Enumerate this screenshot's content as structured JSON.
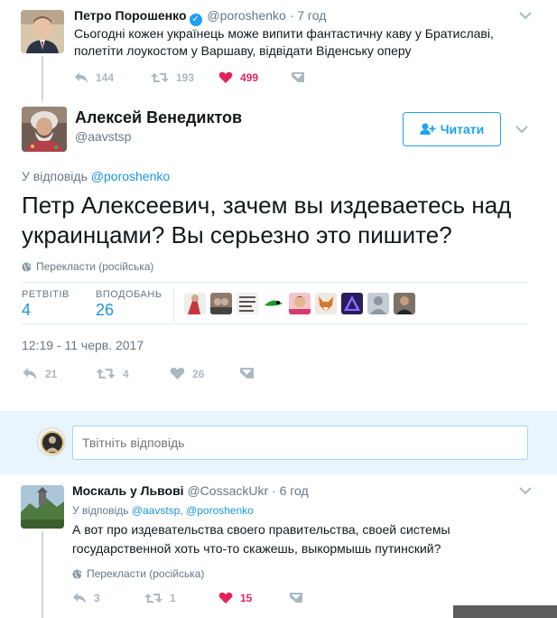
{
  "parent_tweet": {
    "name": "Петро Порошенко",
    "handle": "@poroshenko",
    "time": "· 7 год",
    "text": "Сьогодні кожен українець може випити фантастичну каву у Братиславі, полетіти лоукостом у Варшаву, відвідати Віденську оперу",
    "replies": "144",
    "retweets": "193",
    "likes": "499"
  },
  "main_tweet": {
    "name": "Алексей Венедиктов",
    "handle": "@aavstsp",
    "follow_label": "Читати",
    "reply_prefix": "У відповідь",
    "reply_to": "@poroshenko",
    "text": "Петр Алексеевич, зачем вы издеваетесь над украинцами? Вы серьезно это пишите?",
    "translate": "Перекласти (російська)",
    "retweets_label": "РЕТВІТІВ",
    "retweets_value": "4",
    "likes_label": "ВПОДОБАНЬ",
    "likes_value": "26",
    "timestamp": "12:19 - 11 черв. 2017",
    "action_replies": "21",
    "action_retweets": "4",
    "action_likes": "26"
  },
  "reply_box": {
    "placeholder": "Твітніть відповідь"
  },
  "reply_tweet": {
    "name": "Москаль у Львові",
    "handle": "@CossackUkr",
    "time": "· 6 год",
    "reply_prefix": "У відповідь",
    "reply_to_1": "@aavstsp",
    "reply_sep": ",",
    "reply_to_2": "@poroshenko",
    "text": "А вот про издевательства своего правительства, своей системы государственной хоть что-то скажешь, выкормышь путинский?",
    "translate": "Перекласти (російська)",
    "replies": "3",
    "retweets": "1",
    "likes": "15"
  },
  "colors": {
    "accent": "#1da1f2",
    "link": "#1b95e0",
    "like": "#e0245e",
    "muted": "#657786",
    "reply_bg": "#e8f5fd"
  },
  "icons": [
    "verified-icon",
    "chevron-down-icon",
    "reply-icon",
    "retweet-icon",
    "heart-icon",
    "dm-icon",
    "follow-icon",
    "globe-icon"
  ]
}
